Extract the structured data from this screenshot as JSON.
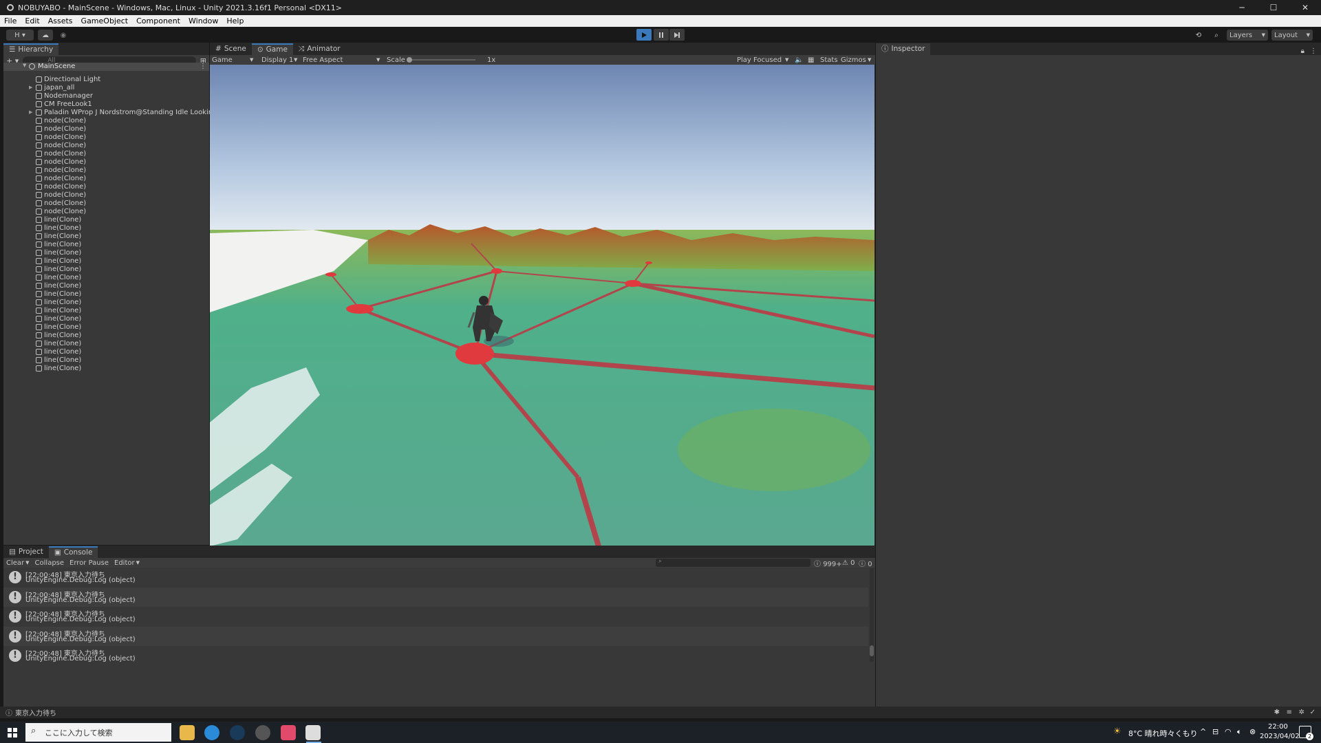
{
  "window": {
    "title": "NOBUYABO - MainScene - Windows, Mac, Linux - Unity 2021.3.16f1 Personal <DX11>",
    "min": "─",
    "max": "☐",
    "close": "✕"
  },
  "menu": [
    "File",
    "Edit",
    "Assets",
    "GameObject",
    "Component",
    "Window",
    "Help"
  ],
  "toolbar": {
    "account": "H ▾",
    "layers": "Layers",
    "layout": "Layout"
  },
  "hierarchy": {
    "tab": "Hierarchy",
    "add": "+ ▾",
    "search_placeholder": "All",
    "scene": "MainScene",
    "items": [
      {
        "name": "Directional Light",
        "expand": ""
      },
      {
        "name": "japan_all",
        "expand": "▶"
      },
      {
        "name": "Nodemanager",
        "expand": ""
      },
      {
        "name": "CM FreeLook1",
        "expand": ""
      },
      {
        "name": "Paladin WProp J Nordstrom@Standing Idle Looking Ver. 2",
        "expand": "▶"
      },
      {
        "name": "node(Clone)",
        "expand": ""
      },
      {
        "name": "node(Clone)",
        "expand": ""
      },
      {
        "name": "node(Clone)",
        "expand": ""
      },
      {
        "name": "node(Clone)",
        "expand": ""
      },
      {
        "name": "node(Clone)",
        "expand": ""
      },
      {
        "name": "node(Clone)",
        "expand": ""
      },
      {
        "name": "node(Clone)",
        "expand": ""
      },
      {
        "name": "node(Clone)",
        "expand": ""
      },
      {
        "name": "node(Clone)",
        "expand": ""
      },
      {
        "name": "node(Clone)",
        "expand": ""
      },
      {
        "name": "node(Clone)",
        "expand": ""
      },
      {
        "name": "node(Clone)",
        "expand": ""
      },
      {
        "name": "line(Clone)",
        "expand": ""
      },
      {
        "name": "line(Clone)",
        "expand": ""
      },
      {
        "name": "line(Clone)",
        "expand": ""
      },
      {
        "name": "line(Clone)",
        "expand": ""
      },
      {
        "name": "line(Clone)",
        "expand": ""
      },
      {
        "name": "line(Clone)",
        "expand": ""
      },
      {
        "name": "line(Clone)",
        "expand": ""
      },
      {
        "name": "line(Clone)",
        "expand": ""
      },
      {
        "name": "line(Clone)",
        "expand": ""
      },
      {
        "name": "line(Clone)",
        "expand": ""
      },
      {
        "name": "line(Clone)",
        "expand": ""
      },
      {
        "name": "line(Clone)",
        "expand": ""
      },
      {
        "name": "line(Clone)",
        "expand": ""
      },
      {
        "name": "line(Clone)",
        "expand": ""
      },
      {
        "name": "line(Clone)",
        "expand": ""
      },
      {
        "name": "line(Clone)",
        "expand": ""
      },
      {
        "name": "line(Clone)",
        "expand": ""
      },
      {
        "name": "line(Clone)",
        "expand": ""
      },
      {
        "name": "line(Clone)",
        "expand": ""
      }
    ]
  },
  "center_tabs": {
    "scene": "Scene",
    "game": "Game",
    "animator": "Animator"
  },
  "game_controls": {
    "mode": "Game",
    "display": "Display 1",
    "aspect": "Free Aspect",
    "scale_label": "Scale",
    "scale_value": "1x",
    "play_focused": "Play Focused",
    "stats": "Stats",
    "gizmos": "Gizmos"
  },
  "inspector": {
    "tab": "Inspector"
  },
  "bottom": {
    "project_tab": "Project",
    "console_tab": "Console",
    "clear": "Clear",
    "collapse": "Collapse",
    "error_pause": "Error Pause",
    "editor": "Editor",
    "count_log": "999+",
    "count_warn": "0",
    "count_error": "0",
    "logs": [
      {
        "line1": "[22:00:48] 東京入力待ち",
        "line2": "UnityEngine.Debug:Log (object)"
      },
      {
        "line1": "[22:00:48] 東京入力待ち",
        "line2": "UnityEngine.Debug:Log (object)"
      },
      {
        "line1": "[22:00:48] 東京入力待ち",
        "line2": "UnityEngine.Debug:Log (object)"
      },
      {
        "line1": "[22:00:48] 東京入力待ち",
        "line2": "UnityEngine.Debug:Log (object)"
      },
      {
        "line1": "[22:00:48] 東京入力待ち",
        "line2": "UnityEngine.Debug:Log (object)"
      }
    ]
  },
  "status": {
    "message": "東京入力待ち"
  },
  "taskbar": {
    "search_placeholder": "ここに入力して検索",
    "weather": "8°C 晴れ時々くもり",
    "time": "22:00",
    "date": "2023/04/02",
    "notif": "2"
  }
}
